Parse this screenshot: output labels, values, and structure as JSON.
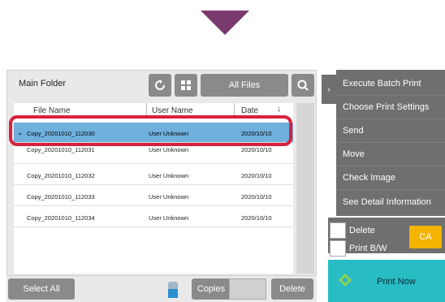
{
  "folder": {
    "title": "Main Folder"
  },
  "toolbar": {
    "filter_label": "All Files"
  },
  "table": {
    "headers": [
      "File Name",
      "User Name",
      "Date"
    ],
    "rows": [
      {
        "file": "Copy_20201010_112030",
        "user": "User Unknown",
        "date": "2020/10/10",
        "selected": true
      },
      {
        "file": "Copy_20201010_112031",
        "user": "User Unknown",
        "date": "2020/10/10"
      },
      {
        "file": "Copy_20201010_112032",
        "user": "User Unknown",
        "date": "2020/10/10"
      },
      {
        "file": "Copy_20201010_112033",
        "user": "User Unknown",
        "date": "2020/10/10"
      },
      {
        "file": "Copy_20201010_112034",
        "user": "User Unknown",
        "date": "2020/10/10"
      }
    ]
  },
  "bottom": {
    "select_all": "Select All",
    "copies": "Copies",
    "delete": "Delete"
  },
  "menu": {
    "items": [
      "Execute Batch Print",
      "Choose Print Settings",
      "Send",
      "Move",
      "Check Image",
      "See Detail Information"
    ]
  },
  "options": {
    "delete": "Delete",
    "print_bw": "Print B/W",
    "ca": "CA"
  },
  "print_now": "Print Now",
  "colors": {
    "accent": "#28bcc4",
    "selected_row": "#6fb0dd",
    "highlight": "#d8203e",
    "indicator": "#7b3a6e",
    "ca": "#f5b400"
  }
}
